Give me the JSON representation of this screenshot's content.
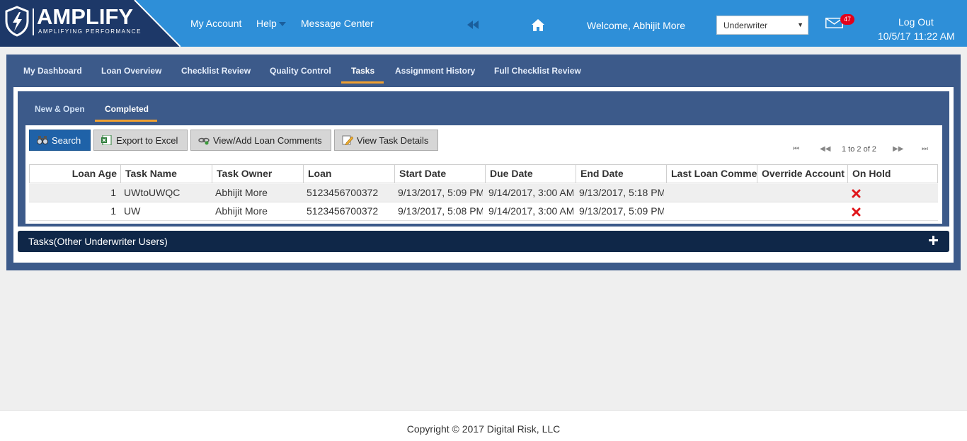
{
  "header": {
    "logo_text": "AMPLIFY",
    "logo_subtitle": "AMPLIFYING PERFORMANCE",
    "nav": [
      {
        "label": "My Account"
      },
      {
        "label": "Help"
      },
      {
        "label": "Message Center"
      }
    ],
    "welcome": "Welcome, Abhijit More",
    "role_select": {
      "value": "Underwriter",
      "caret": "▼"
    },
    "mail_count": "47",
    "logout": "Log Out",
    "datetime": "10/5/17 11:22 AM",
    "icons": [
      "shield-logo-icon",
      "rewind-icon",
      "home-icon",
      "mail-icon"
    ]
  },
  "tabs": [
    {
      "label": "My Dashboard"
    },
    {
      "label": "Loan Overview"
    },
    {
      "label": "Checklist Review"
    },
    {
      "label": "Quality Control"
    },
    {
      "label": "Tasks",
      "active": true
    },
    {
      "label": "Assignment History"
    },
    {
      "label": "Full Checklist Review"
    }
  ],
  "subtabs": [
    {
      "label": "New & Open"
    },
    {
      "label": "Completed",
      "active": true
    }
  ],
  "toolbar": {
    "search": "Search",
    "export": "Export to Excel",
    "comments": "View/Add Loan Comments",
    "details": "View Task Details"
  },
  "pager": {
    "text": "1 to 2 of 2",
    "first": "⏮",
    "prev": "◀◀",
    "next": "▶▶",
    "last": "⏭"
  },
  "table": {
    "columns": [
      "Loan Age",
      "Task Name",
      "Task Owner",
      "Loan",
      "Start Date",
      "Due Date",
      "End Date",
      "Last Loan Comme",
      "Override Account",
      "On Hold"
    ],
    "rows": [
      {
        "age": "1",
        "task": "UWtoUWQC",
        "owner": "Abhijit More",
        "loan": "5123456700372",
        "start": "9/13/2017, 5:09 PM",
        "due": "9/14/2017, 3:00 AM",
        "end": "9/13/2017, 5:18 PM",
        "comment": "",
        "override": "",
        "on_hold": false
      },
      {
        "age": "1",
        "task": "UW",
        "owner": "Abhijit More",
        "loan": "5123456700372",
        "start": "9/13/2017, 5:08 PM",
        "due": "9/14/2017, 3:00 AM",
        "end": "9/13/2017, 5:09 PM",
        "comment": "",
        "override": "",
        "on_hold": false
      }
    ]
  },
  "other_section": {
    "title": "Tasks(Other Underwriter Users)"
  },
  "footer": {
    "copyright": "Copyright © 2017 Digital Risk, LLC"
  },
  "colors": {
    "header_blue": "#2e8fd8",
    "panel_blue": "#3c5a8a",
    "accent_orange": "#f0a030",
    "dark_bar": "#0f2748",
    "primary_button": "#1f62a8"
  }
}
